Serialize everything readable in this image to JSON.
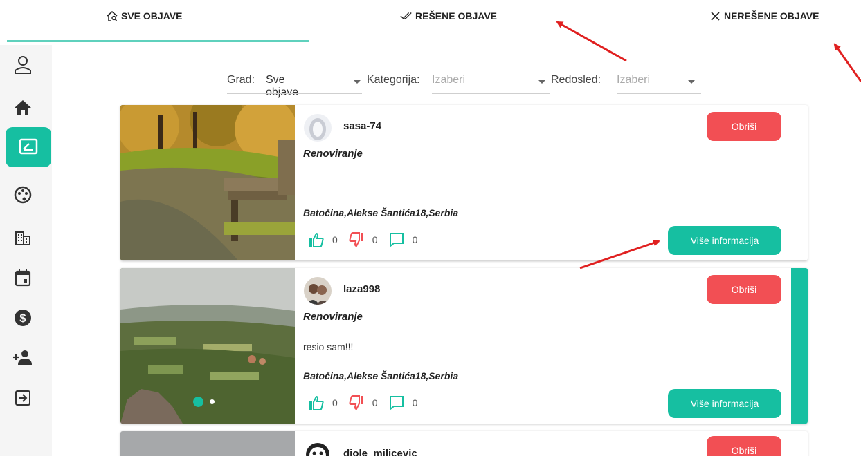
{
  "tabs": [
    {
      "label": "SVE OBJAVE",
      "icon": "home-search-icon"
    },
    {
      "label": "REŠENE OBJAVE",
      "icon": "double-check-icon"
    },
    {
      "label": "NEREŠENE OBJAVE",
      "icon": "close-icon"
    }
  ],
  "sidebar": {
    "items": [
      {
        "icon": "user-icon"
      },
      {
        "icon": "home-icon"
      },
      {
        "icon": "posts-icon",
        "active": true
      },
      {
        "icon": "palette-icon"
      },
      {
        "icon": "building-icon"
      },
      {
        "icon": "calendar-icon"
      },
      {
        "icon": "dollar-icon"
      },
      {
        "icon": "add-user-icon"
      },
      {
        "icon": "logout-icon"
      }
    ]
  },
  "filters": {
    "city_label": "Grad:",
    "city_value": "Sve objave",
    "category_label": "Kategorija:",
    "category_placeholder": "Izaberi",
    "order_label": "Redosled:",
    "order_placeholder": "Izaberi"
  },
  "posts": [
    {
      "username": "sasa-74",
      "category": "Renoviranje",
      "description": "",
      "address": "Batočina,Alekse Šantića18,Serbia",
      "likes": "0",
      "dislikes": "0",
      "comments": "0",
      "delete_label": "Obriši",
      "more_label": "Više informacija"
    },
    {
      "username": "laza998",
      "category": "Renoviranje",
      "description": "resio sam!!!",
      "address": "Batočina,Alekse Šantića18,Serbia",
      "likes": "0",
      "dislikes": "0",
      "comments": "0",
      "delete_label": "Obriši",
      "more_label": "Više informacija"
    },
    {
      "username": "djole_milicevic",
      "delete_label": "Obriši"
    }
  ],
  "colors": {
    "accent": "#16bfa1",
    "danger": "#f24f54",
    "annotation_arrow": "#e02020"
  }
}
